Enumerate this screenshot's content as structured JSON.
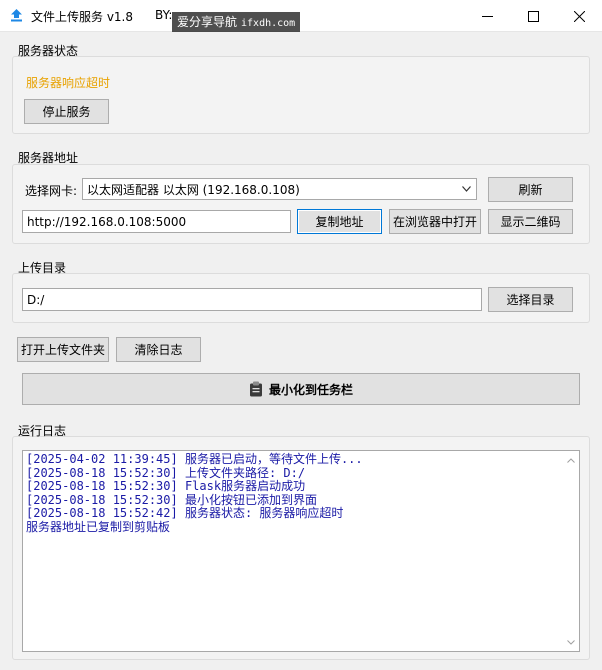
{
  "window": {
    "title": "文件上传服务 v1.8",
    "author_prefix": "BY:",
    "watermark_text": "爱分享导航",
    "watermark_url": "ifxdh.com"
  },
  "server_status": {
    "group_label": "服务器状态",
    "status_text": "服务器响应超时",
    "status_color": "#e8a200",
    "stop_button": "停止服务"
  },
  "server_address": {
    "group_label": "服务器地址",
    "nic_label": "选择网卡:",
    "nic_selected": "以太网适配器 以太网 (192.168.0.108)",
    "refresh_button": "刷新",
    "url_value": "http://192.168.0.108:5000",
    "copy_button": "复制地址",
    "open_browser_button": "在浏览器中打开",
    "qr_button": "显示二维码"
  },
  "upload_dir": {
    "group_label": "上传目录",
    "path_value": "D:/",
    "choose_button": "选择目录"
  },
  "actions": {
    "open_folder_button": "打开上传文件夹",
    "clear_log_button": "清除日志",
    "minimize_button": "最小化到任务栏"
  },
  "log": {
    "group_label": "运行日志",
    "lines": [
      "[2025-04-02 11:39:45] 服务器已启动，等待文件上传...",
      "[2025-08-18 15:52:30] 上传文件夹路径: D:/",
      "[2025-08-18 15:52:30] Flask服务器启动成功",
      "[2025-08-18 15:52:30] 最小化按钮已添加到界面",
      "[2025-08-18 15:52:42] 服务器状态: 服务器响应超时",
      "服务器地址已复制到剪贴板"
    ],
    "text_color": "#1a1aa6"
  },
  "colors": {
    "accent": "#0078d7",
    "window_bg": "#f0f0f0"
  }
}
